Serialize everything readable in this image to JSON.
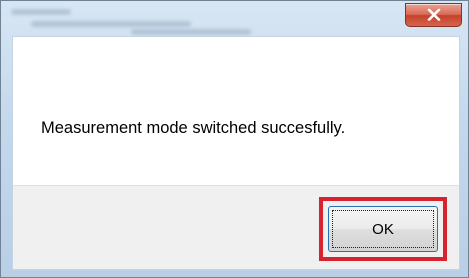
{
  "dialog": {
    "close_icon": "close-icon",
    "message": "Measurement mode switched succesfully.",
    "ok_label": "OK",
    "highlight_color": "#d7222f",
    "close_button_color": "#c4412b"
  }
}
